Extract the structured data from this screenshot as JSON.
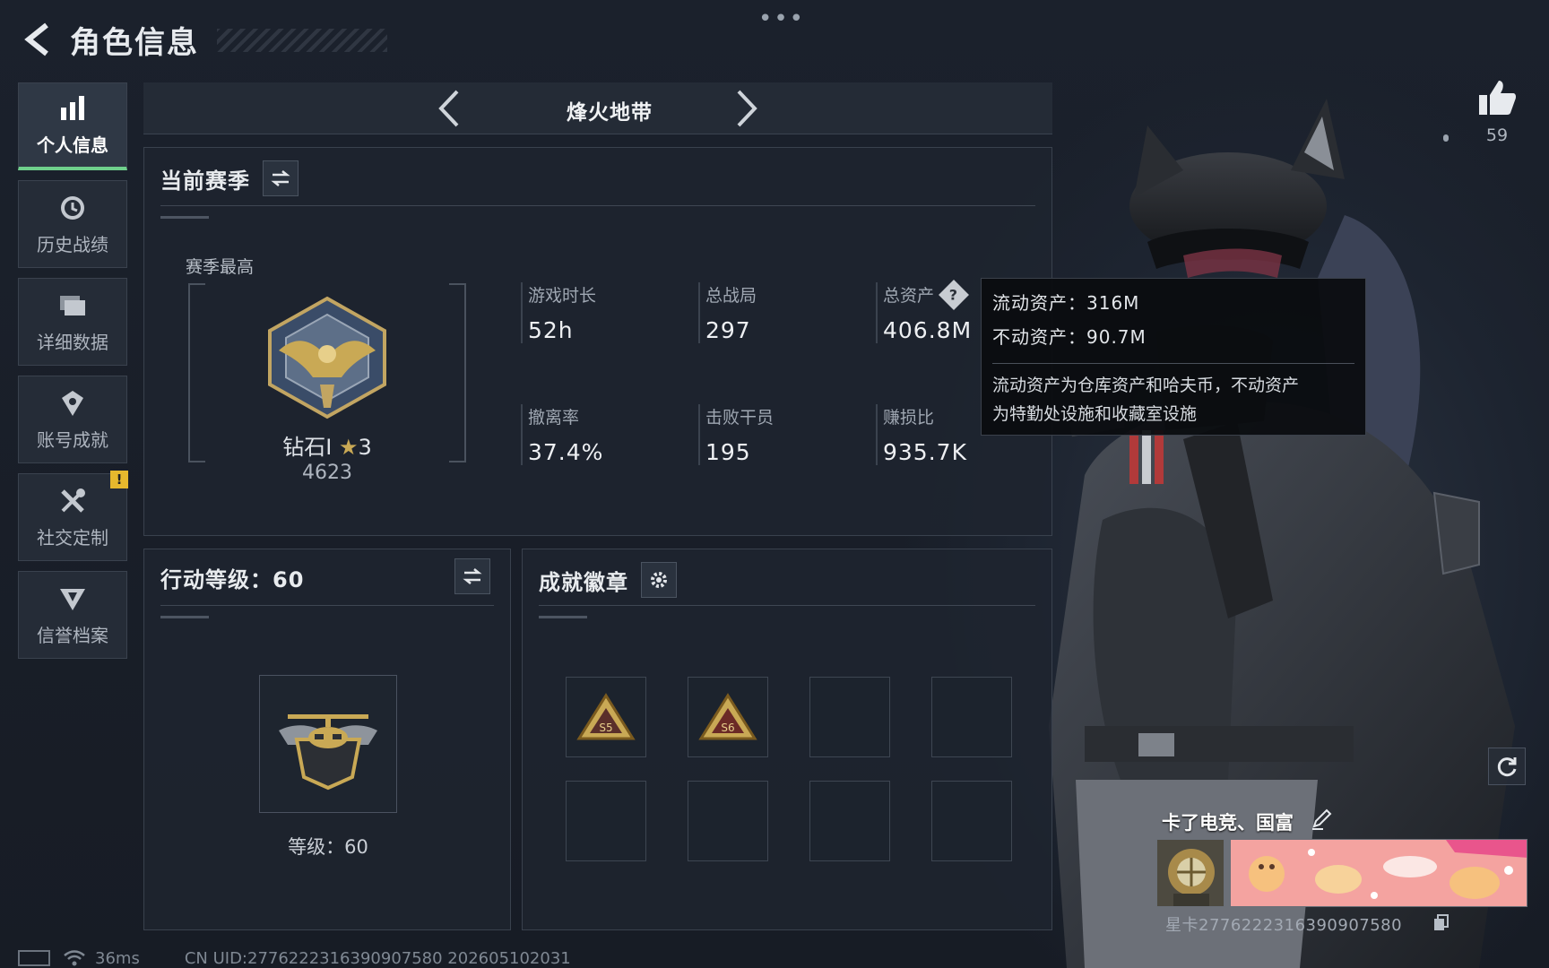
{
  "header": {
    "title": "角色信息",
    "more": "•••"
  },
  "sidebar": {
    "items": [
      {
        "label": "个人信息",
        "icon": "bar-chart-icon",
        "active": true
      },
      {
        "label": "历史战绩",
        "icon": "history-clock-icon"
      },
      {
        "label": "详细数据",
        "icon": "folder-icon"
      },
      {
        "label": "账号成就",
        "icon": "achievement-icon"
      },
      {
        "label": "社交定制",
        "icon": "tools-icon",
        "badge": "!"
      },
      {
        "label": "信誉档案",
        "icon": "credit-shield-icon"
      }
    ]
  },
  "mode": {
    "name": "烽火地带"
  },
  "season": {
    "title": "当前赛季",
    "best_label": "赛季最高",
    "rank_name": "钻石I",
    "rank_star": "★",
    "rank_stars": "3",
    "rank_score": "4623",
    "stats": {
      "play_time": {
        "label": "游戏时长",
        "value": "52h"
      },
      "total_matches": {
        "label": "总战局",
        "value": "297"
      },
      "total_assets": {
        "label": "总资产",
        "value": "406.8M",
        "help": "?"
      },
      "extraction_rate": {
        "label": "撤离率",
        "value": "37.4%"
      },
      "kills": {
        "label": "击败干员",
        "value": "195"
      },
      "profit_ratio": {
        "label": "赚损比",
        "value": "935.7K"
      }
    }
  },
  "tooltip": {
    "liquid": "流动资产：316M",
    "fixed": "不动资产：90.7M",
    "desc_line1": "流动资产为仓库资产和哈夫币，不动资产",
    "desc_line2": "为特勤处设施和收藏室设施"
  },
  "action_level": {
    "title": "行动等级：60",
    "level_text": "等级：60"
  },
  "badges": {
    "title": "成就徽章",
    "slots": [
      {
        "filled": true,
        "label": "S5"
      },
      {
        "filled": true,
        "label": "S6"
      },
      {
        "filled": false
      },
      {
        "filled": false
      },
      {
        "filled": false
      },
      {
        "filled": false
      },
      {
        "filled": false
      },
      {
        "filled": false
      }
    ]
  },
  "likes": {
    "count": "59"
  },
  "player": {
    "name": "卡了电竞、国富",
    "card_uid": "星卡2776222316390907580"
  },
  "status": {
    "ping": "36ms",
    "uid": "CN UID:2776222316390907580 202605102031"
  },
  "colors": {
    "accent_green": "#6fd08c",
    "alert_yellow": "#e6b82d",
    "gold": "#c9a955",
    "panel_bg": "#1e252f"
  }
}
